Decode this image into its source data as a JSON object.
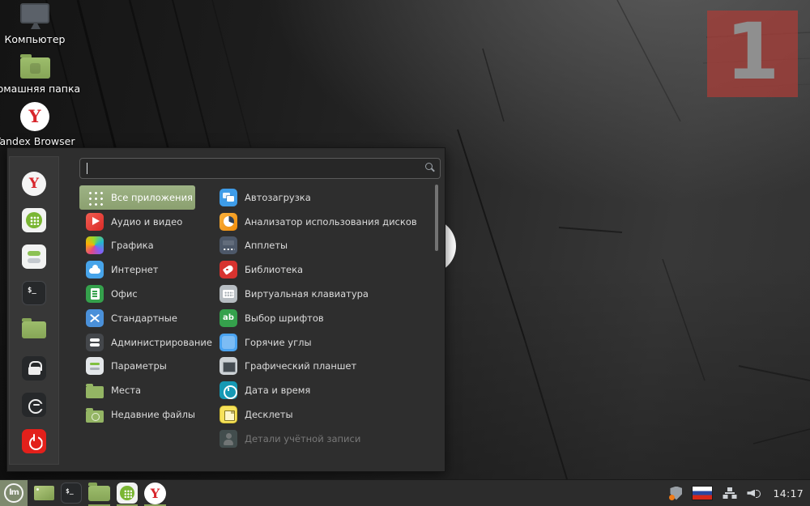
{
  "desktop": {
    "badge": {
      "text": "1"
    },
    "icons": [
      {
        "label": "Компьютер",
        "icon": "computer"
      },
      {
        "label": "Домашняя папка",
        "icon": "home-folder"
      },
      {
        "label": "Yandex Browser",
        "icon": "yandex-browser"
      }
    ]
  },
  "menu": {
    "search": {
      "placeholder": "",
      "value": ""
    },
    "sidebar": [
      {
        "name": "yandex-browser"
      },
      {
        "name": "software-manager"
      },
      {
        "name": "system-settings"
      },
      {
        "name": "terminal"
      },
      {
        "name": "files"
      },
      {
        "name": "lock-screen"
      },
      {
        "name": "logout"
      },
      {
        "name": "shutdown"
      }
    ],
    "categories": [
      {
        "label": "Все приложения",
        "icon": "all-apps",
        "selected": true
      },
      {
        "label": "Аудио и видео",
        "icon": "audio-video"
      },
      {
        "label": "Графика",
        "icon": "graphics"
      },
      {
        "label": "Интернет",
        "icon": "internet"
      },
      {
        "label": "Офис",
        "icon": "office"
      },
      {
        "label": "Стандартные",
        "icon": "accessories"
      },
      {
        "label": "Администрирование",
        "icon": "administration"
      },
      {
        "label": "Параметры",
        "icon": "preferences"
      },
      {
        "label": "Места",
        "icon": "places"
      },
      {
        "label": "Недавние файлы",
        "icon": "recent"
      }
    ],
    "apps": [
      {
        "label": "Автозагрузка",
        "icon": "startup"
      },
      {
        "label": "Анализатор использования дисков",
        "icon": "disk-usage"
      },
      {
        "label": "Апплеты",
        "icon": "applets"
      },
      {
        "label": "Библиотека",
        "icon": "library"
      },
      {
        "label": "Виртуальная клавиатура",
        "icon": "virtual-keyboard"
      },
      {
        "label": "Выбор шрифтов",
        "icon": "font-selection"
      },
      {
        "label": "Горячие углы",
        "icon": "hot-corners"
      },
      {
        "label": "Графический планшет",
        "icon": "graphics-tablet"
      },
      {
        "label": "Дата и время",
        "icon": "date-time"
      },
      {
        "label": "Десклеты",
        "icon": "desklets"
      },
      {
        "label": "Детали учётной записи",
        "icon": "account-details",
        "disabled": true
      }
    ]
  },
  "taskbar": {
    "launchers": [
      {
        "name": "show-desktop",
        "running": false
      },
      {
        "name": "terminal",
        "running": false
      },
      {
        "name": "files",
        "running": true
      },
      {
        "name": "software-manager",
        "running": true
      },
      {
        "name": "yandex-browser",
        "running": true
      }
    ],
    "tray": [
      {
        "name": "update-manager-shield"
      },
      {
        "name": "keyboard-layout-ru-flag"
      },
      {
        "name": "network"
      },
      {
        "name": "volume"
      }
    ],
    "clock": "14:17"
  },
  "colors": {
    "accent_green": "#94a87c",
    "mint_green": "#7ab633",
    "menu_bg": "#2e2e2e",
    "panel_bg": "#2c2c2c",
    "shutdown_red": "#e3201b",
    "badge_red": "#a43e38"
  }
}
